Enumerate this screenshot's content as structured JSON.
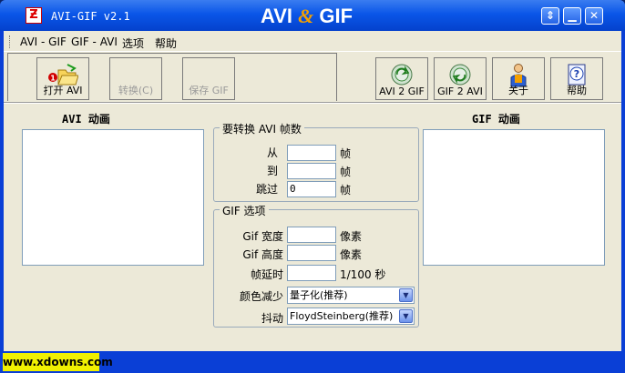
{
  "window": {
    "title": "AVI-GIF v2.1",
    "banner_left": "AVI",
    "banner_amp": "&",
    "banner_right": "GIF",
    "controls": [
      "restore",
      "minimize",
      "close"
    ]
  },
  "menu": [
    "AVI - GIF",
    "GIF - AVI",
    "选项",
    "帮助"
  ],
  "toolbar": {
    "open": "打开 AVI",
    "convert": "转换(C)",
    "save": "保存 GIF",
    "avi2gif": "AVI 2 GIF",
    "gif2avi": "GIF 2 AVI",
    "about": "关于",
    "help": "帮助"
  },
  "left_heading": "AVI  动画",
  "right_heading": "GIF  动画",
  "frames_group": {
    "legend": "要转换 AVI 帧数",
    "from_label": "从",
    "to_label": "到",
    "skip_label": "跳过",
    "from_value": "",
    "to_value": "",
    "skip_value": "0",
    "unit": "帧"
  },
  "gif_group": {
    "legend": "GIF 选项",
    "width_label": "Gif 宽度",
    "height_label": "Gif 高度",
    "delay_label": "帧延时",
    "color_label": "颜色减少",
    "dither_label": "抖动",
    "width_value": "",
    "height_value": "",
    "delay_value": "",
    "pixel_unit": "像素",
    "delay_unit": "1/100 秒",
    "color_selected": "量子化(推荐)",
    "dither_selected": "FloydSteinberg(推荐)"
  },
  "watermark": "www.xdowns.com",
  "colors": {
    "titlebar": "#0a56e8",
    "face": "#ece9d8",
    "accent_amp": "#f4a000"
  }
}
